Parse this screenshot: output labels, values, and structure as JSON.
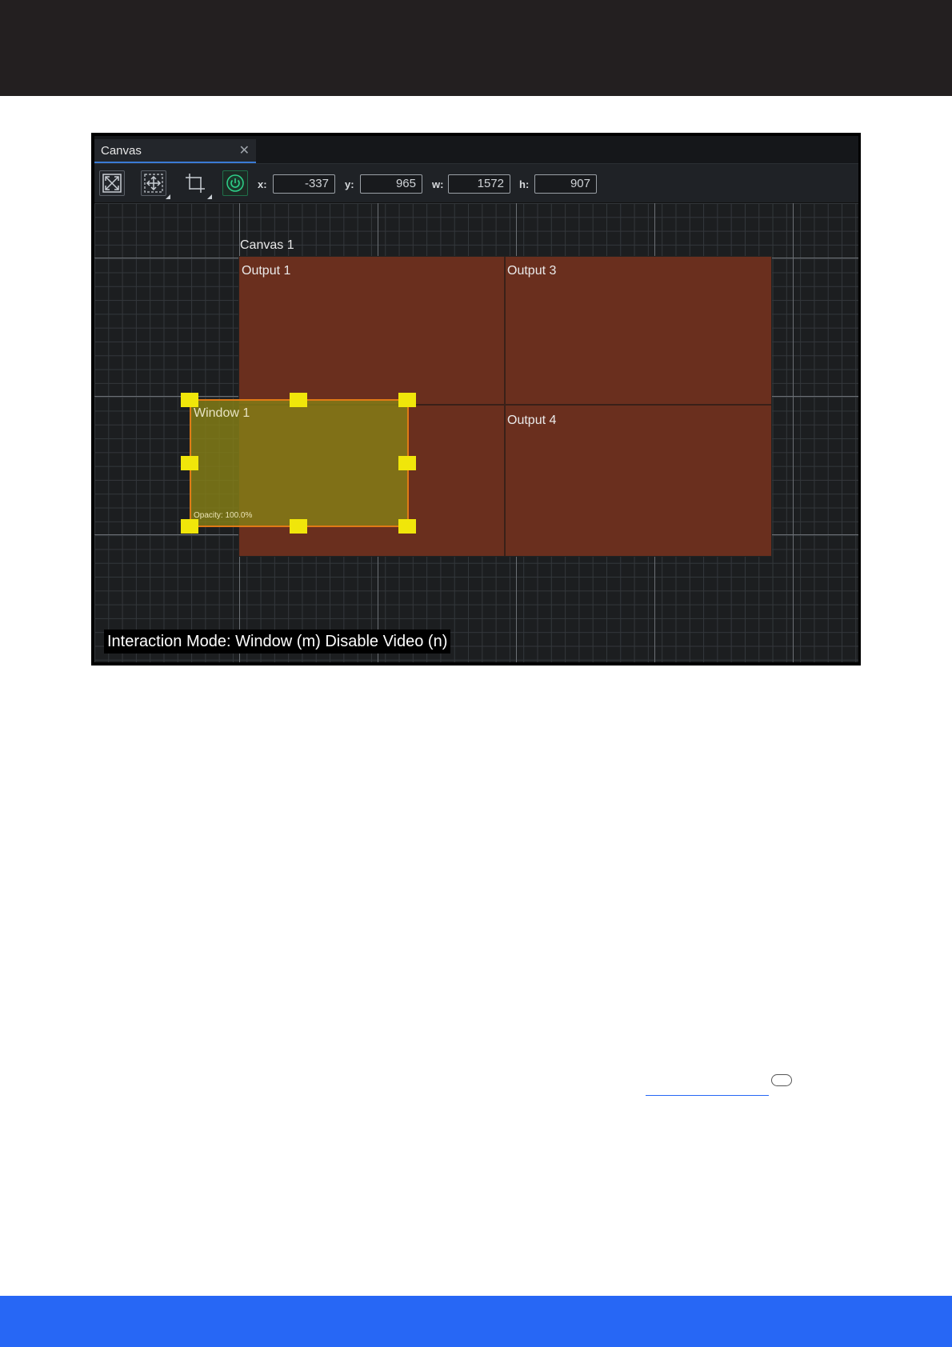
{
  "window": {
    "tab_title": "Canvas",
    "close_symbol": "✕"
  },
  "toolbar": {
    "tools": [
      {
        "name": "fit-to-view",
        "icon": "expand-arrows-icon"
      },
      {
        "name": "move",
        "icon": "move-arrows-icon"
      },
      {
        "name": "crop",
        "icon": "crop-frame-icon"
      },
      {
        "name": "power",
        "icon": "power-icon",
        "color": "#2fd08a"
      }
    ],
    "x_label": "x:",
    "x_value": "-337",
    "y_label": "y:",
    "y_value": "965",
    "w_label": "w:",
    "w_value": "1572",
    "h_label": "h:",
    "h_value": "907"
  },
  "canvas": {
    "name": "Canvas 1",
    "outputs": [
      "Output 1",
      "Output 3",
      "Output 4"
    ],
    "output_color": "#6a2f1e",
    "window": {
      "name": "Window 1",
      "opacity_text": "Opacity: 100.0%",
      "fill_color": "#857f16",
      "border_color": "#e07a16",
      "handle_color": "#f0e60a"
    }
  },
  "status_bar": {
    "text": "Interaction Mode: Window (m) Disable Video (n)"
  },
  "page": {
    "header_color": "#231f20",
    "footer_color": "#2767f5"
  }
}
